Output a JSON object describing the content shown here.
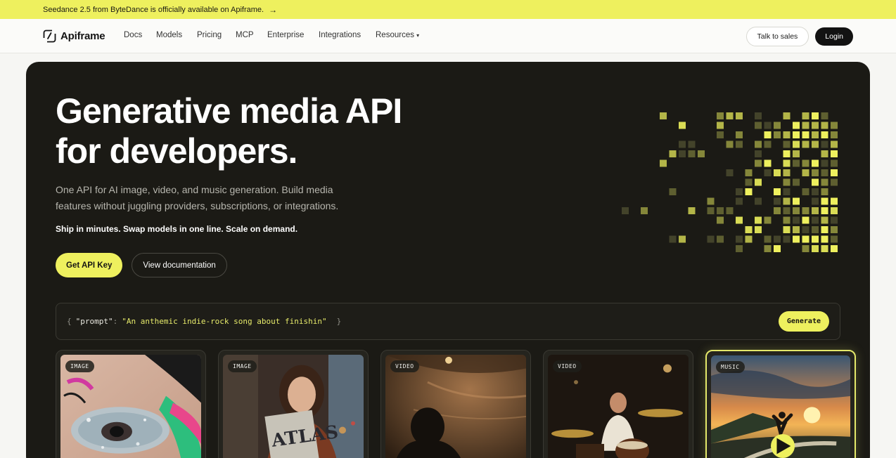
{
  "announcement": {
    "text": "Seedance 2.5 from ByteDance is officially available on Apiframe.",
    "arrow_icon": "arrow-right-icon"
  },
  "nav": {
    "brand": "Apiframe",
    "links": [
      "Docs",
      "Models",
      "Pricing",
      "MCP",
      "Enterprise",
      "Integrations",
      "Resources"
    ],
    "resources_icon": "caret-down-icon",
    "talk_to_sales": "Talk to sales",
    "login": "Login"
  },
  "hero": {
    "headline_line1": "Generative media API",
    "headline_line2": "for developers.",
    "subcopy": "One API for AI image, video, and music generation. Build media features without juggling providers, subscriptions, or integrations.",
    "tagline": "Ship in minutes. Swap models in one line. Scale on demand.",
    "primary_cta": "Get API Key",
    "secondary_cta": "View documentation"
  },
  "prompt": {
    "open_brace": "{",
    "key": "\"prompt\"",
    "colon": ":",
    "value": "\"An anthemic indie-rock song about finishin\"",
    "close_brace": "}",
    "generate": "Generate"
  },
  "cards": [
    {
      "badge": "IMAGE",
      "subject": "glitter-eye-closeup"
    },
    {
      "badge": "IMAGE",
      "subject": "woman-holding-atlas-magazine",
      "magazine_text": "ATLAS"
    },
    {
      "badge": "VIDEO",
      "subject": "figure-in-cave"
    },
    {
      "badge": "VIDEO",
      "subject": "drummer-playing"
    },
    {
      "badge": "MUSIC",
      "subject": "sunset-coast-runner",
      "play_icon": "play-icon",
      "active": true
    }
  ],
  "colors": {
    "accent": "#eef05e",
    "hero_bg": "#1b1a15",
    "page_bg": "#f6f6f3"
  }
}
